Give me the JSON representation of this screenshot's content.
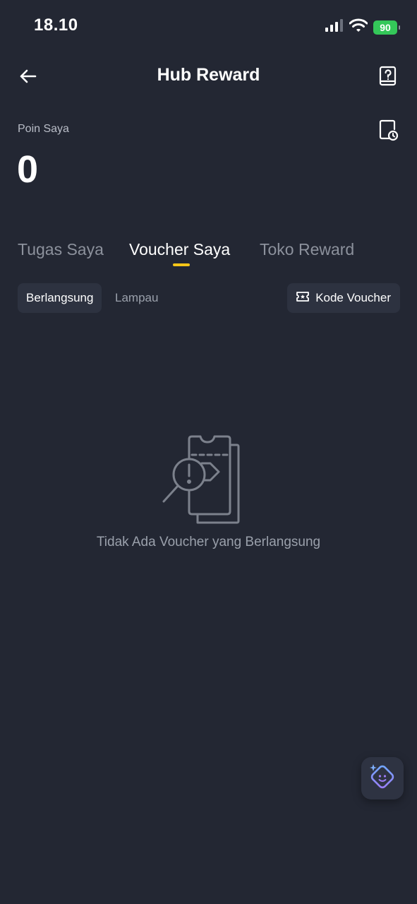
{
  "status_bar": {
    "time": "18.10",
    "battery": "90",
    "icons": [
      "signal-icon",
      "wifi-icon",
      "battery-icon"
    ]
  },
  "header": {
    "title": "Hub Reward",
    "back_icon": "arrow-left-icon",
    "help_icon": "help-book-icon"
  },
  "points": {
    "label": "Poin Saya",
    "value": "0",
    "history_icon": "history-document-icon"
  },
  "tabs": [
    {
      "label": "Tugas Saya",
      "active": false
    },
    {
      "label": "Voucher Saya",
      "active": true
    },
    {
      "label": "Toko Reward",
      "active": false
    }
  ],
  "subfilters": [
    {
      "label": "Berlangsung",
      "active": true
    },
    {
      "label": "Lampau",
      "active": false
    }
  ],
  "voucher_code": {
    "label": "Kode Voucher",
    "icon": "ticket-icon"
  },
  "empty_state": {
    "text": "Tidak Ada Voucher yang Berlangsung",
    "icon": "voucher-search-illustration-icon"
  },
  "fab": {
    "icon": "ai-assistant-icon"
  },
  "colors": {
    "background": "#232733",
    "accent": "#f5c518",
    "chip_bg": "#2d3240",
    "battery": "#34c759",
    "fab_icon": "#8a7cf0"
  }
}
